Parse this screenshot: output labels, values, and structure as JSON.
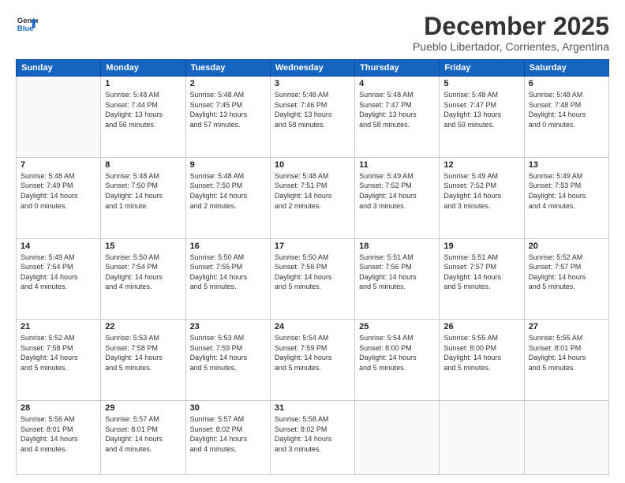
{
  "logo": {
    "line1": "General",
    "line2": "Blue"
  },
  "title": "December 2025",
  "subtitle": "Pueblo Libertador, Corrientes, Argentina",
  "weekdays": [
    "Sunday",
    "Monday",
    "Tuesday",
    "Wednesday",
    "Thursday",
    "Friday",
    "Saturday"
  ],
  "weeks": [
    [
      {
        "day": "",
        "info": ""
      },
      {
        "day": "1",
        "info": "Sunrise: 5:48 AM\nSunset: 7:44 PM\nDaylight: 13 hours\nand 56 minutes."
      },
      {
        "day": "2",
        "info": "Sunrise: 5:48 AM\nSunset: 7:45 PM\nDaylight: 13 hours\nand 57 minutes."
      },
      {
        "day": "3",
        "info": "Sunrise: 5:48 AM\nSunset: 7:46 PM\nDaylight: 13 hours\nand 58 minutes."
      },
      {
        "day": "4",
        "info": "Sunrise: 5:48 AM\nSunset: 7:47 PM\nDaylight: 13 hours\nand 58 minutes."
      },
      {
        "day": "5",
        "info": "Sunrise: 5:48 AM\nSunset: 7:47 PM\nDaylight: 13 hours\nand 59 minutes."
      },
      {
        "day": "6",
        "info": "Sunrise: 5:48 AM\nSunset: 7:48 PM\nDaylight: 14 hours\nand 0 minutes."
      }
    ],
    [
      {
        "day": "7",
        "info": "Sunrise: 5:48 AM\nSunset: 7:49 PM\nDaylight: 14 hours\nand 0 minutes."
      },
      {
        "day": "8",
        "info": "Sunrise: 5:48 AM\nSunset: 7:50 PM\nDaylight: 14 hours\nand 1 minute."
      },
      {
        "day": "9",
        "info": "Sunrise: 5:48 AM\nSunset: 7:50 PM\nDaylight: 14 hours\nand 2 minutes."
      },
      {
        "day": "10",
        "info": "Sunrise: 5:48 AM\nSunset: 7:51 PM\nDaylight: 14 hours\nand 2 minutes."
      },
      {
        "day": "11",
        "info": "Sunrise: 5:49 AM\nSunset: 7:52 PM\nDaylight: 14 hours\nand 3 minutes."
      },
      {
        "day": "12",
        "info": "Sunrise: 5:49 AM\nSunset: 7:52 PM\nDaylight: 14 hours\nand 3 minutes."
      },
      {
        "day": "13",
        "info": "Sunrise: 5:49 AM\nSunset: 7:53 PM\nDaylight: 14 hours\nand 4 minutes."
      }
    ],
    [
      {
        "day": "14",
        "info": "Sunrise: 5:49 AM\nSunset: 7:54 PM\nDaylight: 14 hours\nand 4 minutes."
      },
      {
        "day": "15",
        "info": "Sunrise: 5:50 AM\nSunset: 7:54 PM\nDaylight: 14 hours\nand 4 minutes."
      },
      {
        "day": "16",
        "info": "Sunrise: 5:50 AM\nSunset: 7:55 PM\nDaylight: 14 hours\nand 5 minutes."
      },
      {
        "day": "17",
        "info": "Sunrise: 5:50 AM\nSunset: 7:56 PM\nDaylight: 14 hours\nand 5 minutes."
      },
      {
        "day": "18",
        "info": "Sunrise: 5:51 AM\nSunset: 7:56 PM\nDaylight: 14 hours\nand 5 minutes."
      },
      {
        "day": "19",
        "info": "Sunrise: 5:51 AM\nSunset: 7:57 PM\nDaylight: 14 hours\nand 5 minutes."
      },
      {
        "day": "20",
        "info": "Sunrise: 5:52 AM\nSunset: 7:57 PM\nDaylight: 14 hours\nand 5 minutes."
      }
    ],
    [
      {
        "day": "21",
        "info": "Sunrise: 5:52 AM\nSunset: 7:58 PM\nDaylight: 14 hours\nand 5 minutes."
      },
      {
        "day": "22",
        "info": "Sunrise: 5:53 AM\nSunset: 7:58 PM\nDaylight: 14 hours\nand 5 minutes."
      },
      {
        "day": "23",
        "info": "Sunrise: 5:53 AM\nSunset: 7:59 PM\nDaylight: 14 hours\nand 5 minutes."
      },
      {
        "day": "24",
        "info": "Sunrise: 5:54 AM\nSunset: 7:59 PM\nDaylight: 14 hours\nand 5 minutes."
      },
      {
        "day": "25",
        "info": "Sunrise: 5:54 AM\nSunset: 8:00 PM\nDaylight: 14 hours\nand 5 minutes."
      },
      {
        "day": "26",
        "info": "Sunrise: 5:55 AM\nSunset: 8:00 PM\nDaylight: 14 hours\nand 5 minutes."
      },
      {
        "day": "27",
        "info": "Sunrise: 5:55 AM\nSunset: 8:01 PM\nDaylight: 14 hours\nand 5 minutes."
      }
    ],
    [
      {
        "day": "28",
        "info": "Sunrise: 5:56 AM\nSunset: 8:01 PM\nDaylight: 14 hours\nand 4 minutes."
      },
      {
        "day": "29",
        "info": "Sunrise: 5:57 AM\nSunset: 8:01 PM\nDaylight: 14 hours\nand 4 minutes."
      },
      {
        "day": "30",
        "info": "Sunrise: 5:57 AM\nSunset: 8:02 PM\nDaylight: 14 hours\nand 4 minutes."
      },
      {
        "day": "31",
        "info": "Sunrise: 5:58 AM\nSunset: 8:02 PM\nDaylight: 14 hours\nand 3 minutes."
      },
      {
        "day": "",
        "info": ""
      },
      {
        "day": "",
        "info": ""
      },
      {
        "day": "",
        "info": ""
      }
    ]
  ]
}
